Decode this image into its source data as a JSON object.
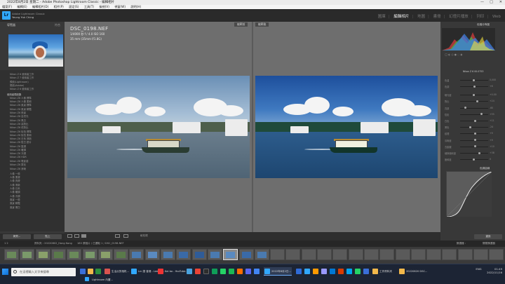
{
  "window": {
    "title": "2022年8月2日 星期二 - Adobe Photoshop Lightroom Classic - 編輯相片"
  },
  "menu": [
    "檔案(F)",
    "編輯(E)",
    "編輯相片(D)",
    "相片(P)",
    "設定(S)",
    "工具(T)",
    "檢視(V)",
    "視窗(W)",
    "說明(H)"
  ],
  "identity": {
    "line1": "Adobe Lightroom Classic",
    "line2": "Yeung Yuk Ching"
  },
  "modules": [
    {
      "label": "圖庫",
      "active": false
    },
    {
      "label": "編輯相片",
      "active": true
    },
    {
      "label": "地圖",
      "active": false
    },
    {
      "label": "書冊",
      "active": false
    },
    {
      "label": "幻燈片播放",
      "active": false
    },
    {
      "label": "列印",
      "active": false
    },
    {
      "label": "Web",
      "active": false
    }
  ],
  "left": {
    "navigator": "導覽器",
    "fit_options": "符合",
    "items_a": [
      "Nikon Z 6 使用者工作",
      "Nikon Z 7 使用者工作",
      "預設(Lightroom)",
      "預設(Adobe)",
      "Nikon Z 6 使用者工作"
    ],
    "group_header": "使用者預設集",
    "items_b": [
      "Nikon Z6 人像 標準",
      "Nikon Z6 人像 柔和",
      "Nikon Z6 風景 標準",
      "Nikon Z6 風景 鮮豔",
      "Nikon Z6 夜景",
      "Nikon Z6 自然光",
      "Nikon Z6 黑白",
      "Nikon Z6 高對比",
      "Nikon Z6 低對比",
      "Nikon Z6 街拍 標準",
      "Nikon Z6 街拍 柔和",
      "Nikon Z6 日系 清新",
      "Nikon Z6 復古 膠片",
      "Nikon Z6 藍調",
      "Nikon Z6 暖調",
      "Nikon Z6 冷調",
      "Nikon Z6 HDR",
      "Nikon Z6 電影感",
      "Nikon Z6 霧化",
      "Nikon Z6 清晰"
    ],
    "items_c": [
      "人像 一般",
      "人像 柔膚",
      "人像 亮膚",
      "人像 清新",
      "人像 日系",
      "人像 暖調",
      "人像 冷調",
      "風景 一般",
      "風景 鮮豔",
      "風景 黑白"
    ],
    "copy_btn": "拷貝...",
    "paste_btn": "貼上"
  },
  "photo": {
    "filename": "DSC_0198.NEF",
    "exposure": "1/4000 秒   f / 4.0    ISO 160",
    "lens": "35 mm (35mm f/1.8G)"
  },
  "compare": {
    "before": "編輯前",
    "after": "編輯後"
  },
  "toolbar": {
    "label": "軟校樣"
  },
  "right": {
    "histogram": "色階分佈圖",
    "profile_label": "Nikon Z 6 00.0753",
    "section_curve": "色調曲線",
    "reset_btn": "重設",
    "sliders": [
      {
        "label": "色溫",
        "value": "5,000"
      },
      {
        "label": "色調",
        "value": "+6"
      },
      {
        "label": "曝光度",
        "value": "+0.00"
      },
      {
        "label": "對比",
        "value": "+24"
      },
      {
        "label": "亮部",
        "value": "-60"
      },
      {
        "label": "陰影",
        "value": "+55"
      },
      {
        "label": "白色",
        "value": "+11"
      },
      {
        "label": "黑色",
        "value": "-24"
      },
      {
        "label": "紋理",
        "value": "+9"
      },
      {
        "label": "清晰度",
        "value": "+9"
      },
      {
        "label": "去朦朧",
        "value": "+10"
      },
      {
        "label": "細節飽和度",
        "value": "+38"
      },
      {
        "label": "飽和度",
        "value": "0"
      }
    ]
  },
  "filmstrip": {
    "nav": "1  2",
    "path": "資料夾 : 20220802_Hong Kong",
    "count": "183 張相片 / 已選取 1 / DSC_0198.NEF",
    "filter": "篩選器 :",
    "filter_value": "關閉篩選器"
  },
  "taskbar": {
    "search": "在這裡輸入文字來搜尋",
    "apps": [
      "生活点的相机...",
      "Lrc 讀 香港 - Lee Lo...",
      "Kai bo - YouTube...",
      "2022年8月2日...",
      "工作資料夾",
      "20220820 DSC...",
      "Lightroom 內置..."
    ],
    "time": "01:49",
    "date": "2022/11/16",
    "lang": "ENG"
  },
  "colors": {
    "accent": "#31a8ff",
    "panel": "#383838",
    "center": "#5a5a5a"
  }
}
